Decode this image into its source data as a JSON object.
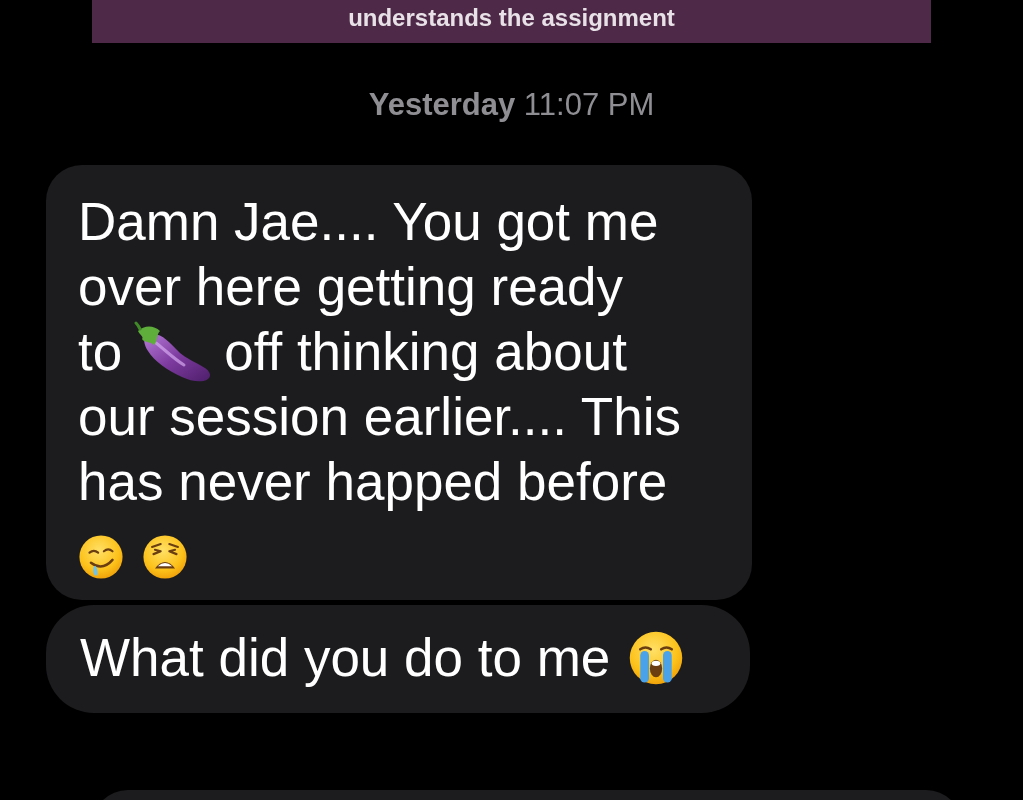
{
  "banner": {
    "text": "understands the assignment"
  },
  "timestamp": {
    "text": "**Yesterday** 11:07 PM"
  },
  "messages": [
    {
      "blocks": [
        {
          "kind": "text",
          "text": "Damn Jae.... You got me over here getting ready"
        },
        {
          "kind": "line",
          "items": [
            {
              "kind": "text",
              "text": "to"
            },
            {
              "kind": "eggplant"
            },
            {
              "kind": "text",
              "text": "off thinking about"
            }
          ]
        },
        {
          "kind": "text",
          "text": "our session earlier.... This has never happed before"
        },
        {
          "kind": "line",
          "items": [
            {
              "kind": "drooling"
            },
            {
              "kind": "weary"
            }
          ]
        }
      ]
    },
    {
      "blocks": [
        {
          "kind": "line",
          "items": [
            {
              "kind": "text",
              "text": "What did you do to me"
            },
            {
              "kind": "crying"
            }
          ]
        }
      ]
    }
  ]
}
